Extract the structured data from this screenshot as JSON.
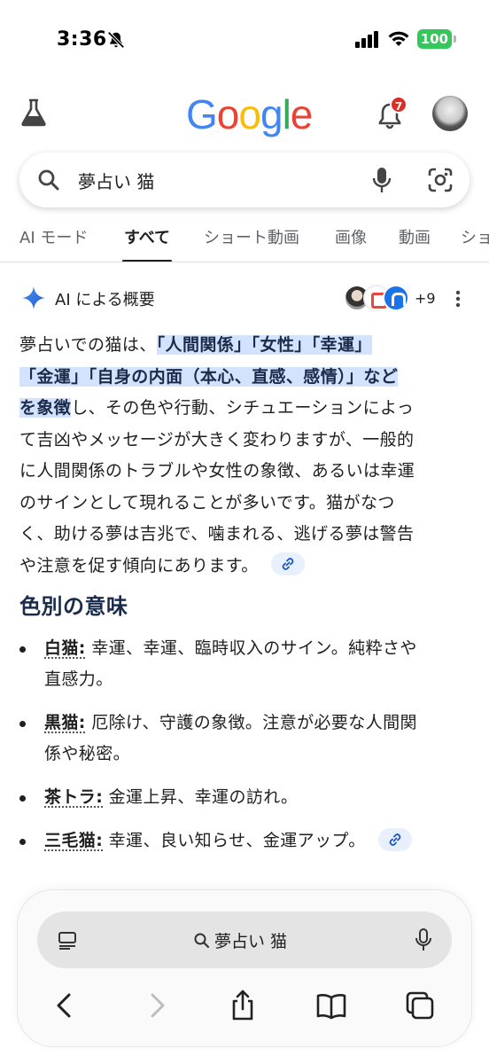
{
  "status": {
    "time": "3:36",
    "battery": "100"
  },
  "header": {
    "logo_letters": [
      {
        "ch": "G",
        "color": "#4285F4"
      },
      {
        "ch": "o",
        "color": "#EA4335"
      },
      {
        "ch": "o",
        "color": "#FBBC05"
      },
      {
        "ch": "g",
        "color": "#4285F4"
      },
      {
        "ch": "l",
        "color": "#34A853"
      },
      {
        "ch": "e",
        "color": "#EA4335"
      }
    ],
    "notification_count": "7"
  },
  "search": {
    "query": "夢占い 猫"
  },
  "tabs": [
    "AI モード",
    "すべて",
    "ショート動画",
    "画像",
    "動画",
    "ショ"
  ],
  "active_tab": "すべて",
  "ai_overview": {
    "title": "AI による概要",
    "sources_more": "+9",
    "lines": [
      {
        "parts": [
          {
            "t": "夢占いでの猫は、",
            "h": false
          },
          {
            "t": "「人間関係」「女性」「幸運」",
            "h": true
          }
        ]
      },
      {
        "parts": [
          {
            "t": "「金運」「自身の内面（本心、直感、感情）」など",
            "h": true
          }
        ]
      },
      {
        "parts": [
          {
            "t": "を象徴",
            "h": true
          },
          {
            "t": "し、その色や行動、シチュエーションによっ",
            "h": false
          }
        ]
      },
      {
        "parts": [
          {
            "t": "て吉凶やメッセージが大きく変わりますが、一般的",
            "h": false
          }
        ]
      },
      {
        "parts": [
          {
            "t": "に人間関係のトラブルや女性の象徴、あるいは幸運",
            "h": false
          }
        ]
      },
      {
        "parts": [
          {
            "t": "のサインとして現れることが多いです。猫がなつ",
            "h": false
          }
        ]
      },
      {
        "parts": [
          {
            "t": "く、助ける夢は吉兆で、噛まれる、逃げる夢は警告",
            "h": false
          }
        ]
      },
      {
        "parts": [
          {
            "t": "や注意を促す傾向にあります。",
            "h": false
          }
        ]
      }
    ]
  },
  "section": {
    "title": "色別の意味",
    "items": [
      {
        "term": "白猫:",
        "line1": " 幸運、幸運、臨時収入のサイン。純粋さや",
        "line2": "直感力。"
      },
      {
        "term": "黒猫:",
        "line1": " 厄除け、守護の象徴。注意が必要な人間関",
        "line2": "係や秘密。"
      },
      {
        "term": "茶トラ:",
        "line1": " 金運上昇、幸運の訪れ。",
        "line2": ""
      },
      {
        "term": "三毛猫:",
        "line1": " 幸運、良い知らせ、金運アップ。",
        "line2": ""
      }
    ]
  },
  "browser": {
    "url_text": "夢占い 猫"
  }
}
